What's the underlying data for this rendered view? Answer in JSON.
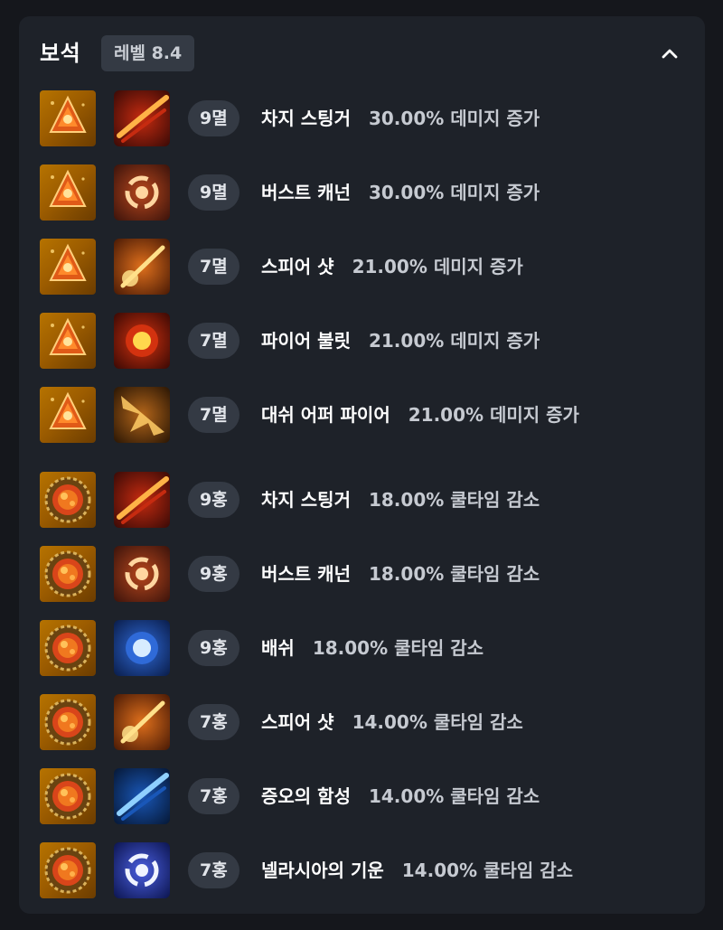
{
  "header": {
    "title": "보석",
    "level_label": "레벨 8.4",
    "collapse_icon": "chevron-up-icon"
  },
  "gems": [
    {
      "tier": "9멸",
      "skill": "차지 스팅거",
      "effect": "30.00% 데미지 증가",
      "gem_icon": "annihilation-gem-icon",
      "skill_icon": "charge-stinger-skill-icon"
    },
    {
      "tier": "9멸",
      "skill": "버스트 캐넌",
      "effect": "30.00% 데미지 증가",
      "gem_icon": "annihilation-gem-icon",
      "skill_icon": "burst-cannon-skill-icon"
    },
    {
      "tier": "7멸",
      "skill": "스피어 샷",
      "effect": "21.00% 데미지 증가",
      "gem_icon": "annihilation-gem-icon",
      "skill_icon": "spear-shot-skill-icon"
    },
    {
      "tier": "7멸",
      "skill": "파이어 불릿",
      "effect": "21.00% 데미지 증가",
      "gem_icon": "annihilation-gem-icon",
      "skill_icon": "fire-bullet-skill-icon"
    },
    {
      "tier": "7멸",
      "skill": "대쉬 어퍼 파이어",
      "effect": "21.00% 데미지 증가",
      "gem_icon": "annihilation-gem-icon",
      "skill_icon": "dash-upper-fire-skill-icon"
    },
    {
      "tier": "9홍",
      "skill": "차지 스팅거",
      "effect": "18.00% 쿨타임 감소",
      "gem_icon": "crimson-flame-gem-icon",
      "skill_icon": "charge-stinger-skill-icon"
    },
    {
      "tier": "9홍",
      "skill": "버스트 캐넌",
      "effect": "18.00% 쿨타임 감소",
      "gem_icon": "crimson-flame-gem-icon",
      "skill_icon": "burst-cannon-skill-icon"
    },
    {
      "tier": "9홍",
      "skill": "배쉬",
      "effect": "18.00% 쿨타임 감소",
      "gem_icon": "crimson-flame-gem-icon",
      "skill_icon": "bash-skill-icon"
    },
    {
      "tier": "7홍",
      "skill": "스피어 샷",
      "effect": "14.00% 쿨타임 감소",
      "gem_icon": "crimson-flame-gem-icon",
      "skill_icon": "spear-shot-skill-icon"
    },
    {
      "tier": "7홍",
      "skill": "증오의 함성",
      "effect": "14.00% 쿨타임 감소",
      "gem_icon": "crimson-flame-gem-icon",
      "skill_icon": "roar-of-hatred-skill-icon"
    },
    {
      "tier": "7홍",
      "skill": "넬라시아의 기운",
      "effect": "14.00% 쿨타임 감소",
      "gem_icon": "crimson-flame-gem-icon",
      "skill_icon": "nellasias-energy-skill-icon"
    }
  ],
  "colors": {
    "panel_bg": "#1e2229",
    "badge_bg": "#343a44",
    "gem_bg": "#b67300"
  }
}
